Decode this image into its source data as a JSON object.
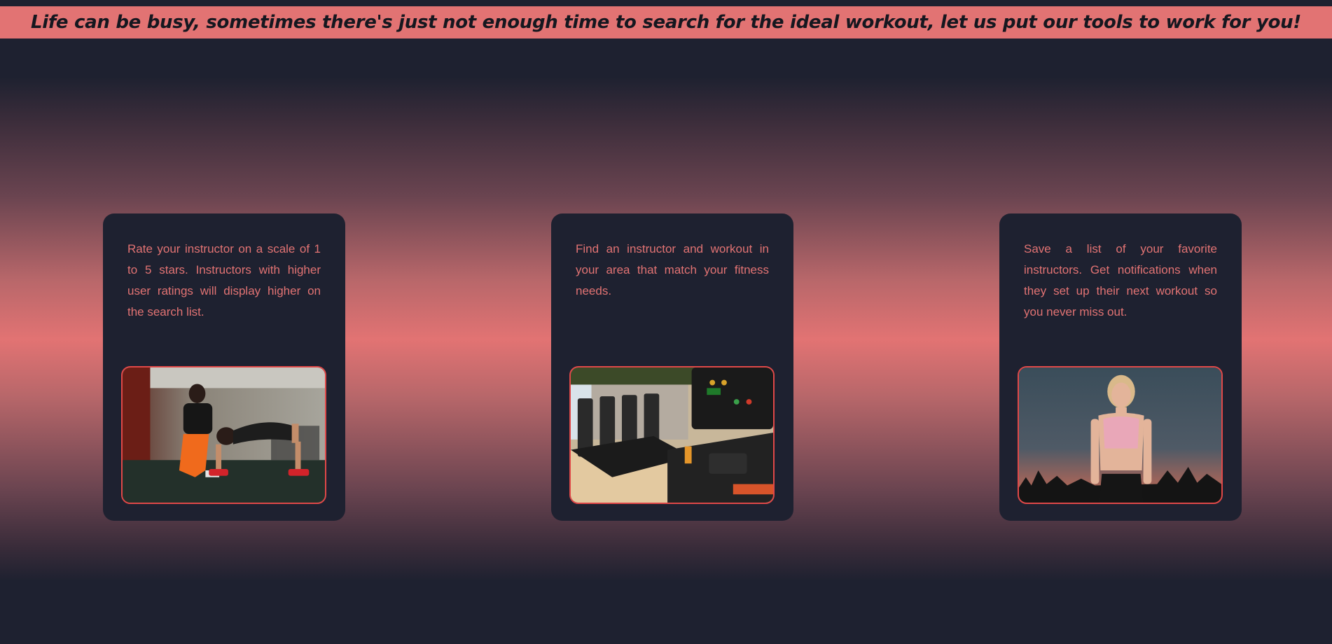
{
  "banner": {
    "text": "Life can be busy, sometimes there's just not enough time to search for the ideal workout, let us put our tools to work for you!"
  },
  "cards": [
    {
      "text": "Rate your instructor on a scale of 1 to 5 stars. Instructors with higher user ratings will display higher on the search list.",
      "photo": "instructor-training-photo"
    },
    {
      "text": "Find an instructor and workout in your area that match your fitness needs.",
      "photo": "gym-treadmills-photo"
    },
    {
      "text": "Save a list of your favorite instructors. Get notifications when they set up their next workout so you never miss out.",
      "photo": "fitness-woman-sunset-photo"
    }
  ],
  "colors": {
    "accent": "#e27373",
    "card_bg": "#1e2130",
    "photo_border": "#e04848",
    "banner_text": "#15171f"
  }
}
